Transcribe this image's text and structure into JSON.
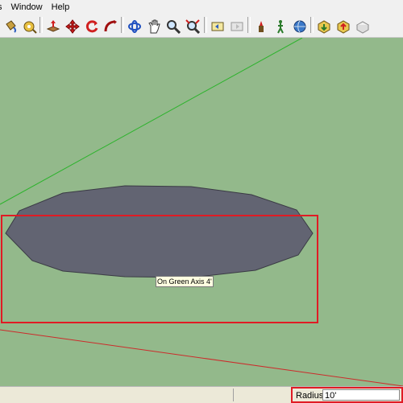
{
  "menu": {
    "items": [
      "s",
      "Window",
      "Help"
    ]
  },
  "toolbar": {
    "tools": [
      {
        "icon": "paint-bucket-icon"
      },
      {
        "icon": "tape-measure-icon"
      },
      {
        "icon": "push-pull-icon"
      },
      {
        "icon": "move-icon"
      },
      {
        "icon": "rotate-icon"
      },
      {
        "icon": "follow-me-icon"
      },
      {
        "icon": "orbit-icon"
      },
      {
        "icon": "pan-icon"
      },
      {
        "icon": "zoom-icon"
      },
      {
        "icon": "zoom-extents-icon"
      },
      {
        "icon": "previous-view-icon"
      },
      {
        "icon": "next-view-icon"
      },
      {
        "icon": "position-camera-icon"
      },
      {
        "icon": "walk-icon"
      },
      {
        "icon": "look-around-icon"
      },
      {
        "icon": "get-models-icon"
      },
      {
        "icon": "share-model-icon"
      },
      {
        "icon": "components-icon"
      }
    ]
  },
  "viewport": {
    "tooltip": "On Green Axis 4'",
    "axis_colors": {
      "green": "#2db32d",
      "red": "#cc2b2b"
    },
    "shape_fill": "#626472"
  },
  "status": {
    "vcb_label": "Radius",
    "vcb_value": "10'"
  }
}
